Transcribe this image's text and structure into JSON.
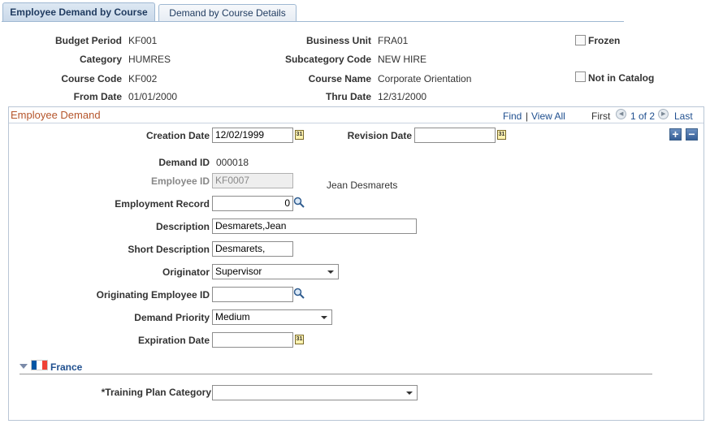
{
  "tabs": [
    {
      "label": "Employee Demand by Course"
    },
    {
      "label": "Demand by Course Details"
    }
  ],
  "header": {
    "budget_period_label": "Budget Period",
    "budget_period": "KF001",
    "category_label": "Category",
    "category": "HUMRES",
    "course_code_label": "Course Code",
    "course_code": "KF002",
    "from_date_label": "From Date",
    "from_date": "01/01/2000",
    "business_unit_label": "Business Unit",
    "business_unit": "FRA01",
    "subcategory_label": "Subcategory Code",
    "subcategory": "NEW HIRE",
    "course_name_label": "Course Name",
    "course_name": "Corporate Orientation",
    "thru_date_label": "Thru Date",
    "thru_date": "12/31/2000",
    "frozen_label": "Frozen",
    "not_in_catalog_label": "Not in Catalog"
  },
  "scroll": {
    "title": "Employee Demand",
    "find": "Find",
    "separator": "|",
    "view_all": "View All",
    "first": "First",
    "counter": "1 of 2",
    "last": "Last"
  },
  "form": {
    "creation_date_label": "Creation Date",
    "creation_date": "12/02/1999",
    "revision_date_label": "Revision Date",
    "revision_date": "",
    "demand_id_label": "Demand ID",
    "demand_id": "000018",
    "employee_id_label": "Employee ID",
    "employee_id": "KF0007",
    "employee_name": "Jean Desmarets",
    "employment_record_label": "Employment Record",
    "employment_record": "0",
    "description_label": "Description",
    "description": "Desmarets,Jean",
    "short_description_label": "Short Description",
    "short_description": "Desmarets,",
    "originator_label": "Originator",
    "originator": "Supervisor",
    "originating_employee_label": "Originating Employee ID",
    "originating_employee": "",
    "demand_priority_label": "Demand Priority",
    "demand_priority": "Medium",
    "expiration_date_label": "Expiration Date",
    "expiration_date": ""
  },
  "france": {
    "section_label": "France",
    "training_plan_label": "*Training Plan Category",
    "training_plan": ""
  },
  "icons": {
    "calendar": "31",
    "add": "+",
    "delete": "−",
    "prev": "◀",
    "next": "▶"
  },
  "colors": {
    "section_title": "#b5552b",
    "link": "#1f4f8f",
    "flag_blue": "#0055a4",
    "flag_white": "#ffffff",
    "flag_red": "#ef4135"
  }
}
